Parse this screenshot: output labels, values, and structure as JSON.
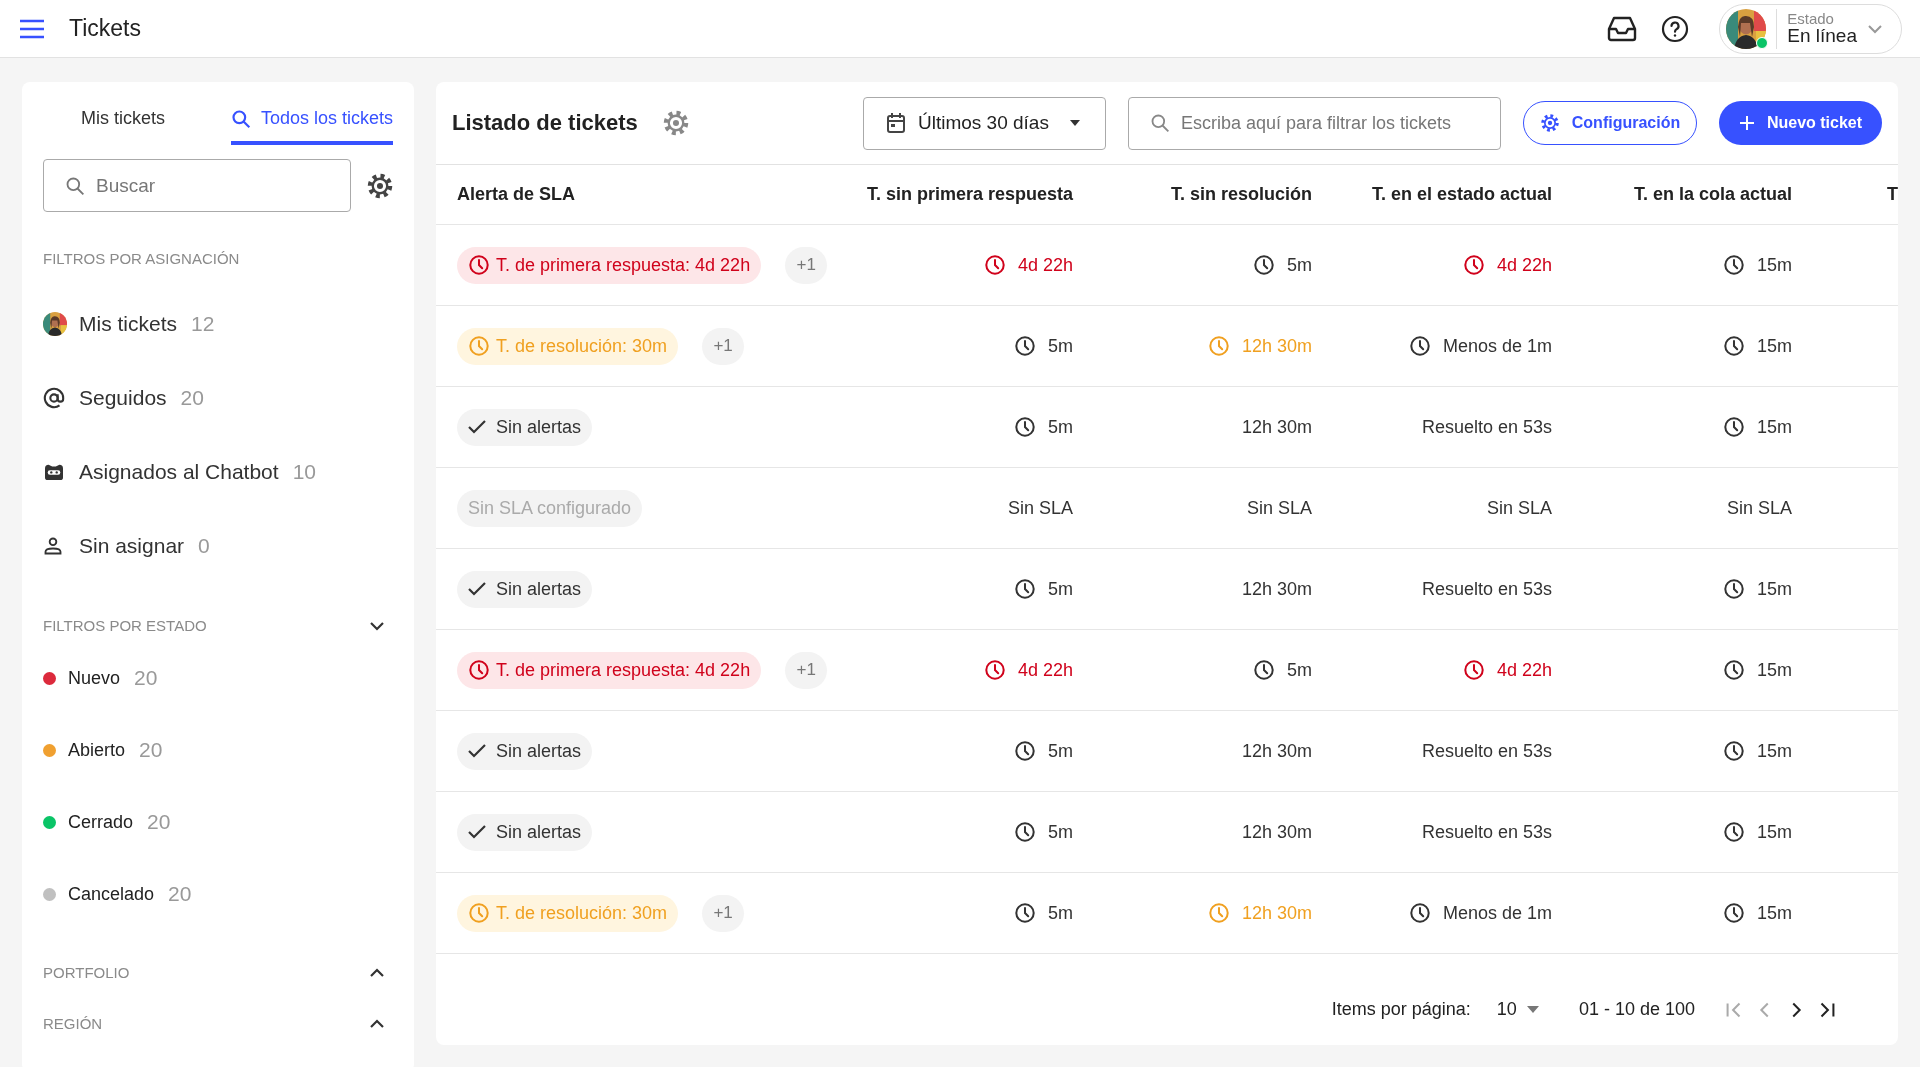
{
  "app": {
    "title": "Tickets"
  },
  "user": {
    "status_label": "Estado",
    "status": "En línea",
    "online": true
  },
  "sidebar": {
    "tabs": [
      {
        "label": "Mis tickets",
        "kind": "plain",
        "selected": false
      },
      {
        "label": "Todos los tickets",
        "kind": "search",
        "selected": true
      }
    ],
    "search": {
      "placeholder": "Buscar"
    },
    "assignment": {
      "title": "FILTROS POR ASIGNACIÓN",
      "items": [
        {
          "kind": "avatar",
          "label": "Mis tickets",
          "count": "12"
        },
        {
          "kind": "at",
          "label": "Seguidos",
          "count": "20"
        },
        {
          "kind": "bot",
          "label": "Asignados al Chatbot",
          "count": "10"
        },
        {
          "kind": "person",
          "label": "Sin asignar",
          "count": "0"
        }
      ]
    },
    "sections": [
      {
        "title": "FILTROS POR ESTADO",
        "expanded": true,
        "items": [
          {
            "label": "Nuevo",
            "count": "20",
            "color": "#dc2a3c"
          },
          {
            "label": "Abierto",
            "count": "20",
            "color": "#f0a030"
          },
          {
            "label": "Cerrado",
            "count": "20",
            "color": "#0ac467"
          },
          {
            "label": "Cancelado",
            "count": "20",
            "color": "#c0c0c0"
          }
        ]
      },
      {
        "title": "PORTFOLIO",
        "expanded": false
      },
      {
        "title": "REGIÓN",
        "expanded": false
      }
    ]
  },
  "list": {
    "title": "Listado de tickets",
    "date_filter": "Últimos 30 días",
    "filter": {
      "placeholder": "Escriba aquí para filtrar los tickets"
    },
    "buttons": [
      {
        "kind": "outline",
        "label": "Configuración"
      },
      {
        "kind": "primary",
        "label": "Nuevo ticket"
      }
    ]
  },
  "table": {
    "columns": [
      "Alerta de SLA",
      "T. sin primera respuesta",
      "T. sin resolución",
      "T. en el estado actual",
      "T. en la cola actual",
      "T"
    ],
    "rows": [
      {
        "cells": [
          {
            "kind": "danger",
            "text": "T. de primera respuesta: 4d 22h",
            "extra": "+1"
          },
          {
            "kind": "time",
            "text": "4d 22h",
            "icon": true,
            "color": "#d0021b"
          },
          {
            "kind": "time",
            "text": "5m",
            "icon": true,
            "color": "#333333"
          },
          {
            "kind": "time",
            "text": "4d 22h",
            "icon": true,
            "color": "#d0021b"
          },
          {
            "kind": "time",
            "text": "15m",
            "icon": true,
            "color": "#333333"
          }
        ]
      },
      {
        "cells": [
          {
            "kind": "warning",
            "text": "T. de resolución: 30m",
            "extra": "+1"
          },
          {
            "kind": "time",
            "text": "5m",
            "icon": true,
            "color": "#333333"
          },
          {
            "kind": "time",
            "text": "12h 30m",
            "icon": true,
            "color": "#f0a020"
          },
          {
            "kind": "time",
            "text": "Menos de 1m",
            "icon": true,
            "color": "#333333"
          },
          {
            "kind": "time",
            "text": "15m",
            "icon": true,
            "color": "#333333"
          }
        ]
      },
      {
        "cells": [
          {
            "kind": "ok",
            "text": "Sin alertas"
          },
          {
            "kind": "time",
            "text": "5m",
            "icon": true,
            "color": "#333333"
          },
          {
            "kind": "time",
            "text": "12h 30m",
            "icon": false,
            "color": "#333333"
          },
          {
            "kind": "time",
            "text": "Resuelto en 53s",
            "icon": false,
            "color": "#333333"
          },
          {
            "kind": "time",
            "text": "15m",
            "icon": true,
            "color": "#333333"
          }
        ]
      },
      {
        "cells": [
          {
            "kind": "none",
            "text": "Sin SLA configurado"
          },
          {
            "kind": "time",
            "text": "Sin SLA",
            "icon": false,
            "color": "#333333"
          },
          {
            "kind": "time",
            "text": "Sin SLA",
            "icon": false,
            "color": "#333333"
          },
          {
            "kind": "time",
            "text": "Sin SLA",
            "icon": false,
            "color": "#333333"
          },
          {
            "kind": "time",
            "text": "Sin SLA",
            "icon": false,
            "color": "#333333"
          }
        ]
      },
      {
        "cells": [
          {
            "kind": "ok",
            "text": "Sin alertas"
          },
          {
            "kind": "time",
            "text": "5m",
            "icon": true,
            "color": "#333333"
          },
          {
            "kind": "time",
            "text": "12h 30m",
            "icon": false,
            "color": "#333333"
          },
          {
            "kind": "time",
            "text": "Resuelto en 53s",
            "icon": false,
            "color": "#333333"
          },
          {
            "kind": "time",
            "text": "15m",
            "icon": true,
            "color": "#333333"
          }
        ]
      },
      {
        "cells": [
          {
            "kind": "danger",
            "text": "T. de primera respuesta: 4d 22h",
            "extra": "+1"
          },
          {
            "kind": "time",
            "text": "4d 22h",
            "icon": true,
            "color": "#d0021b"
          },
          {
            "kind": "time",
            "text": "5m",
            "icon": true,
            "color": "#333333"
          },
          {
            "kind": "time",
            "text": "4d 22h",
            "icon": true,
            "color": "#d0021b"
          },
          {
            "kind": "time",
            "text": "15m",
            "icon": true,
            "color": "#333333"
          }
        ]
      },
      {
        "cells": [
          {
            "kind": "ok",
            "text": "Sin alertas"
          },
          {
            "kind": "time",
            "text": "5m",
            "icon": true,
            "color": "#333333"
          },
          {
            "kind": "time",
            "text": "12h 30m",
            "icon": false,
            "color": "#333333"
          },
          {
            "kind": "time",
            "text": "Resuelto en 53s",
            "icon": false,
            "color": "#333333"
          },
          {
            "kind": "time",
            "text": "15m",
            "icon": true,
            "color": "#333333"
          }
        ]
      },
      {
        "cells": [
          {
            "kind": "ok",
            "text": "Sin alertas"
          },
          {
            "kind": "time",
            "text": "5m",
            "icon": true,
            "color": "#333333"
          },
          {
            "kind": "time",
            "text": "12h 30m",
            "icon": false,
            "color": "#333333"
          },
          {
            "kind": "time",
            "text": "Resuelto en 53s",
            "icon": false,
            "color": "#333333"
          },
          {
            "kind": "time",
            "text": "15m",
            "icon": true,
            "color": "#333333"
          }
        ]
      },
      {
        "cells": [
          {
            "kind": "warning",
            "text": "T. de resolución: 30m",
            "extra": "+1"
          },
          {
            "kind": "time",
            "text": "5m",
            "icon": true,
            "color": "#333333"
          },
          {
            "kind": "time",
            "text": "12h 30m",
            "icon": true,
            "color": "#f0a020"
          },
          {
            "kind": "time",
            "text": "Menos de 1m",
            "icon": true,
            "color": "#333333"
          },
          {
            "kind": "time",
            "text": "15m",
            "icon": true,
            "color": "#333333"
          }
        ]
      }
    ]
  },
  "pagination": {
    "per_page_label": "Items por página:",
    "per_page": "10",
    "range": "01 - 10 de 100",
    "nav": [
      {
        "kind": "first",
        "disabled": true
      },
      {
        "kind": "prev",
        "disabled": true
      },
      {
        "kind": "next",
        "disabled": false
      },
      {
        "kind": "last",
        "disabled": false
      }
    ]
  }
}
